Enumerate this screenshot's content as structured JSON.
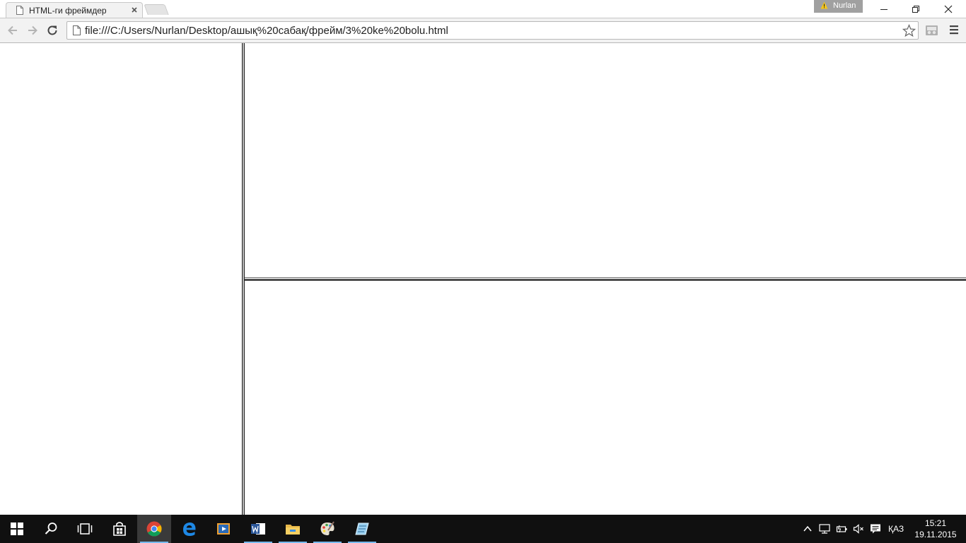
{
  "browser": {
    "tab_title": "HTML-ги фреймдер",
    "profile_name": "Nurlan",
    "url": "file:///C:/Users/Nurlan/Desktop/ашық%20сабақ/фрейм/3%20ke%20bolu.html"
  },
  "icons": {
    "tab": [
      "page-icon",
      "close-icon"
    ],
    "window": [
      "minimize-icon",
      "restore-icon",
      "close-icon"
    ],
    "toolbar": [
      "back-arrow-icon",
      "forward-arrow-icon",
      "reload-icon",
      "page-icon",
      "star-icon",
      "extension-icon",
      "menu-icon"
    ],
    "taskbar": [
      "windows-start-icon",
      "search-icon",
      "task-view-icon",
      "store-icon",
      "chrome-icon",
      "edge-icon",
      "media-player-icon",
      "word-icon",
      "file-explorer-icon",
      "paint-icon",
      "notepad-icon"
    ],
    "tray": [
      "chevron-up-icon",
      "network-icon",
      "battery-icon",
      "volume-muted-icon",
      "notification-icon"
    ]
  },
  "taskbar": {
    "language": "ҚАЗ",
    "time": "15:21",
    "date": "19.11.2015"
  },
  "colors": {
    "taskbar_bg": "#101010",
    "active_underline": "#76b9ed",
    "toolbar_bg": "#f2f2f2",
    "frame_border": "#222222"
  }
}
